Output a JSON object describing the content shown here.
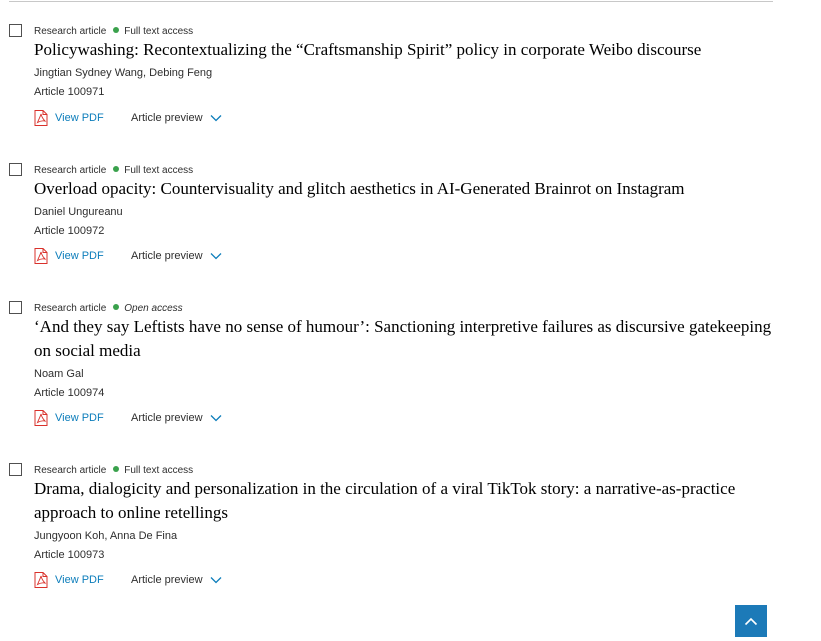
{
  "articles": [
    {
      "type": "Research article",
      "access": "Full text access",
      "title": "Policywashing: Recontextualizing the “Craftsmanship Spirit” policy in corporate Weibo discourse",
      "authors": "Jingtian Sydney Wang, Debing Feng",
      "article_number": "Article 100971",
      "pdf_label": "View PDF",
      "preview_label": "Article preview"
    },
    {
      "type": "Research article",
      "access": "Full text access",
      "title": "Overload opacity: Countervisuality and glitch aesthetics in AI-Generated Brainrot on Instagram",
      "authors": "Daniel Ungureanu",
      "article_number": "Article 100972",
      "pdf_label": "View PDF",
      "preview_label": "Article preview"
    },
    {
      "type": "Research article",
      "access": "Open access",
      "title": "‘And they say Leftists have no sense of humour’: Sanctioning interpretive failures as discursive gatekeeping on social media",
      "authors": "Noam Gal",
      "article_number": "Article 100974",
      "pdf_label": "View PDF",
      "preview_label": "Article preview"
    },
    {
      "type": "Research article",
      "access": "Full text access",
      "title": "Drama, dialogicity and personalization in the circulation of a viral TikTok story: a narrative-as-practice approach to online retellings",
      "authors": "Jungyoon Koh, Anna De Fina",
      "article_number": "Article 100973",
      "pdf_label": "View PDF",
      "preview_label": "Article preview"
    }
  ],
  "colors": {
    "link": "#0c7dbb",
    "access_dot": "#3aa14c",
    "back_to_top": "#1c7ab8",
    "pdf_icon": "#d9312b"
  },
  "icons": {
    "pdf": "pdf-icon",
    "preview": "chevron-down-icon",
    "back_to_top": "arrow-up-icon"
  }
}
